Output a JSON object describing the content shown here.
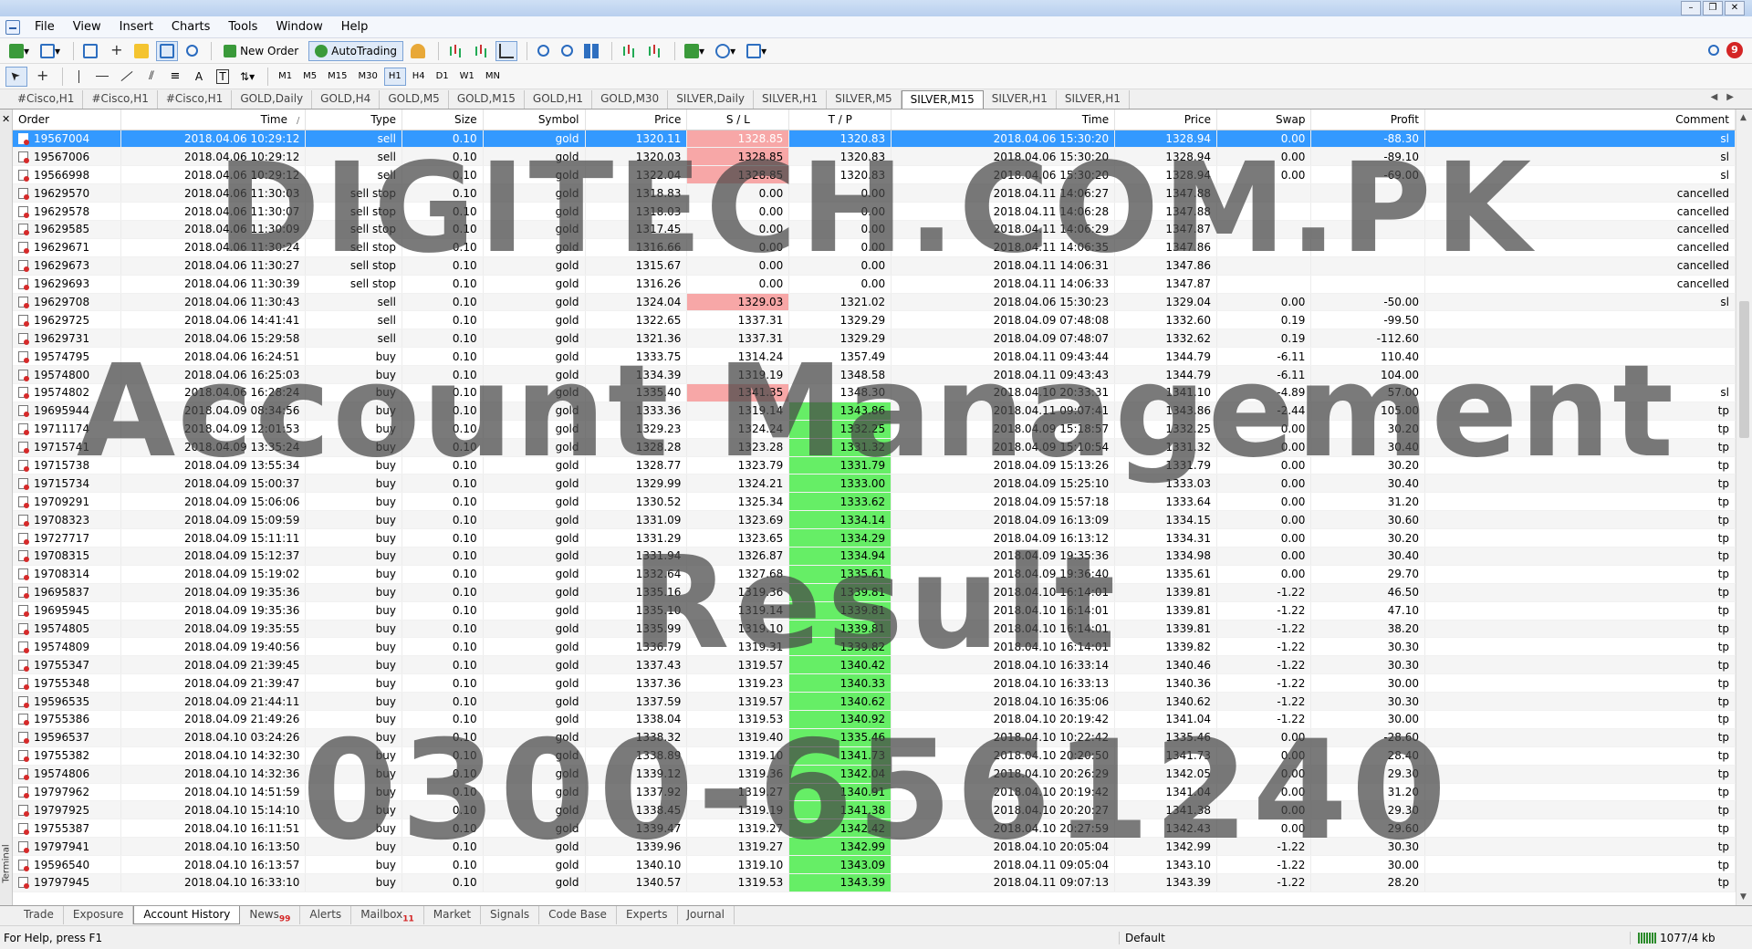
{
  "menu": [
    "File",
    "View",
    "Insert",
    "Charts",
    "Tools",
    "Window",
    "Help"
  ],
  "toolbar": {
    "new_order": "New Order",
    "auto_trading": "AutoTrading",
    "timeframes": [
      "M1",
      "M5",
      "M15",
      "M30",
      "H1",
      "H4",
      "D1",
      "W1",
      "MN"
    ],
    "active_timeframe": "H1",
    "notifications_count": "9"
  },
  "chart_tabs": [
    "#Cisco,H1",
    "#Cisco,H1",
    "#Cisco,H1",
    "GOLD,Daily",
    "GOLD,H4",
    "GOLD,M5",
    "GOLD,M15",
    "GOLD,H1",
    "GOLD,M30",
    "SILVER,Daily",
    "SILVER,H1",
    "SILVER,M5",
    "SILVER,M15",
    "SILVER,H1",
    "SILVER,H1"
  ],
  "active_chart_tab": 12,
  "terminal": {
    "side_label": "Terminal",
    "columns": [
      "Order",
      "Time",
      "Type",
      "Size",
      "Symbol",
      "Price",
      "S / L",
      "T / P",
      "Time",
      "Price",
      "Swap",
      "Profit",
      "Comment"
    ],
    "sort_mark": "/",
    "rows": [
      [
        "19567004",
        "2018.04.06 10:29:12",
        "sell",
        "0.10",
        "gold",
        "1320.11",
        "1328.85",
        "1320.83",
        "2018.04.06 15:30:20",
        "1328.94",
        "0.00",
        "-88.30",
        "sl"
      ],
      [
        "19567006",
        "2018.04.06 10:29:12",
        "sell",
        "0.10",
        "gold",
        "1320.03",
        "1328.85",
        "1320.83",
        "2018.04.06 15:30:20",
        "1328.94",
        "0.00",
        "-89.10",
        "sl"
      ],
      [
        "19566998",
        "2018.04.06 10:29:12",
        "sell",
        "0.10",
        "gold",
        "1322.04",
        "1328.85",
        "1320.83",
        "2018.04.06 15:30:20",
        "1328.94",
        "0.00",
        "-69.00",
        "sl"
      ],
      [
        "19629570",
        "2018.04.06 11:30:03",
        "sell stop",
        "0.10",
        "gold",
        "1318.83",
        "0.00",
        "0.00",
        "2018.04.11 14:06:27",
        "1347.88",
        "",
        "",
        "cancelled"
      ],
      [
        "19629578",
        "2018.04.06 11:30:07",
        "sell stop",
        "0.10",
        "gold",
        "1318.03",
        "0.00",
        "0.00",
        "2018.04.11 14:06:28",
        "1347.88",
        "",
        "",
        "cancelled"
      ],
      [
        "19629585",
        "2018.04.06 11:30:09",
        "sell stop",
        "0.10",
        "gold",
        "1317.45",
        "0.00",
        "0.00",
        "2018.04.11 14:06:29",
        "1347.87",
        "",
        "",
        "cancelled"
      ],
      [
        "19629671",
        "2018.04.06 11:30:24",
        "sell stop",
        "0.10",
        "gold",
        "1316.66",
        "0.00",
        "0.00",
        "2018.04.11 14:06:35",
        "1347.86",
        "",
        "",
        "cancelled"
      ],
      [
        "19629673",
        "2018.04.06 11:30:27",
        "sell stop",
        "0.10",
        "gold",
        "1315.67",
        "0.00",
        "0.00",
        "2018.04.11 14:06:31",
        "1347.86",
        "",
        "",
        "cancelled"
      ],
      [
        "19629693",
        "2018.04.06 11:30:39",
        "sell stop",
        "0.10",
        "gold",
        "1316.26",
        "0.00",
        "0.00",
        "2018.04.11 14:06:33",
        "1347.87",
        "",
        "",
        "cancelled"
      ],
      [
        "19629708",
        "2018.04.06 11:30:43",
        "sell",
        "0.10",
        "gold",
        "1324.04",
        "1329.03",
        "1321.02",
        "2018.04.06 15:30:23",
        "1329.04",
        "0.00",
        "-50.00",
        "sl"
      ],
      [
        "19629725",
        "2018.04.06 14:41:41",
        "sell",
        "0.10",
        "gold",
        "1322.65",
        "1337.31",
        "1329.29",
        "2018.04.09 07:48:08",
        "1332.60",
        "0.19",
        "-99.50",
        ""
      ],
      [
        "19629731",
        "2018.04.06 15:29:58",
        "sell",
        "0.10",
        "gold",
        "1321.36",
        "1337.31",
        "1329.29",
        "2018.04.09 07:48:07",
        "1332.62",
        "0.19",
        "-112.60",
        ""
      ],
      [
        "19574795",
        "2018.04.06 16:24:51",
        "buy",
        "0.10",
        "gold",
        "1333.75",
        "1314.24",
        "1357.49",
        "2018.04.11 09:43:44",
        "1344.79",
        "-6.11",
        "110.40",
        ""
      ],
      [
        "19574800",
        "2018.04.06 16:25:03",
        "buy",
        "0.10",
        "gold",
        "1334.39",
        "1319.19",
        "1348.58",
        "2018.04.11 09:43:43",
        "1344.79",
        "-6.11",
        "104.00",
        ""
      ],
      [
        "19574802",
        "2018.04.06 16:28:24",
        "buy",
        "0.10",
        "gold",
        "1335.40",
        "1341.35",
        "1348.30",
        "2018.04.10 20:33:31",
        "1341.10",
        "-4.89",
        "57.00",
        "sl"
      ],
      [
        "19695944",
        "2018.04.09 08:34:56",
        "buy",
        "0.10",
        "gold",
        "1333.36",
        "1319.14",
        "1343.86",
        "2018.04.11 09:07:41",
        "1343.86",
        "-2.44",
        "105.00",
        "tp"
      ],
      [
        "19711174",
        "2018.04.09 12:01:53",
        "buy",
        "0.10",
        "gold",
        "1329.23",
        "1324.24",
        "1332.25",
        "2018.04.09 15:18:57",
        "1332.25",
        "0.00",
        "30.20",
        "tp"
      ],
      [
        "19715741",
        "2018.04.09 13:35:24",
        "buy",
        "0.10",
        "gold",
        "1328.28",
        "1323.28",
        "1331.32",
        "2018.04.09 15:10:54",
        "1331.32",
        "0.00",
        "30.40",
        "tp"
      ],
      [
        "19715738",
        "2018.04.09 13:55:34",
        "buy",
        "0.10",
        "gold",
        "1328.77",
        "1323.79",
        "1331.79",
        "2018.04.09 15:13:26",
        "1331.79",
        "0.00",
        "30.20",
        "tp"
      ],
      [
        "19715734",
        "2018.04.09 15:00:37",
        "buy",
        "0.10",
        "gold",
        "1329.99",
        "1324.21",
        "1333.00",
        "2018.04.09 15:25:10",
        "1333.03",
        "0.00",
        "30.40",
        "tp"
      ],
      [
        "19709291",
        "2018.04.09 15:06:06",
        "buy",
        "0.10",
        "gold",
        "1330.52",
        "1325.34",
        "1333.62",
        "2018.04.09 15:57:18",
        "1333.64",
        "0.00",
        "31.20",
        "tp"
      ],
      [
        "19708323",
        "2018.04.09 15:09:59",
        "buy",
        "0.10",
        "gold",
        "1331.09",
        "1323.69",
        "1334.14",
        "2018.04.09 16:13:09",
        "1334.15",
        "0.00",
        "30.60",
        "tp"
      ],
      [
        "19727717",
        "2018.04.09 15:11:11",
        "buy",
        "0.10",
        "gold",
        "1331.29",
        "1323.65",
        "1334.29",
        "2018.04.09 16:13:12",
        "1334.31",
        "0.00",
        "30.20",
        "tp"
      ],
      [
        "19708315",
        "2018.04.09 15:12:37",
        "buy",
        "0.10",
        "gold",
        "1331.94",
        "1326.87",
        "1334.94",
        "2018.04.09 19:35:36",
        "1334.98",
        "0.00",
        "30.40",
        "tp"
      ],
      [
        "19708314",
        "2018.04.09 15:19:02",
        "buy",
        "0.10",
        "gold",
        "1332.64",
        "1327.68",
        "1335.61",
        "2018.04.09 19:36:40",
        "1335.61",
        "0.00",
        "29.70",
        "tp"
      ],
      [
        "19695837",
        "2018.04.09 19:35:36",
        "buy",
        "0.10",
        "gold",
        "1335.16",
        "1319.36",
        "1339.81",
        "2018.04.10 16:14:01",
        "1339.81",
        "-1.22",
        "46.50",
        "tp"
      ],
      [
        "19695945",
        "2018.04.09 19:35:36",
        "buy",
        "0.10",
        "gold",
        "1335.10",
        "1319.14",
        "1339.81",
        "2018.04.10 16:14:01",
        "1339.81",
        "-1.22",
        "47.10",
        "tp"
      ],
      [
        "19574805",
        "2018.04.09 19:35:55",
        "buy",
        "0.10",
        "gold",
        "1335.99",
        "1319.10",
        "1339.81",
        "2018.04.10 16:14:01",
        "1339.81",
        "-1.22",
        "38.20",
        "tp"
      ],
      [
        "19574809",
        "2018.04.09 19:40:56",
        "buy",
        "0.10",
        "gold",
        "1336.79",
        "1319.31",
        "1339.82",
        "2018.04.10 16:14:01",
        "1339.82",
        "-1.22",
        "30.30",
        "tp"
      ],
      [
        "19755347",
        "2018.04.09 21:39:45",
        "buy",
        "0.10",
        "gold",
        "1337.43",
        "1319.57",
        "1340.42",
        "2018.04.10 16:33:14",
        "1340.46",
        "-1.22",
        "30.30",
        "tp"
      ],
      [
        "19755348",
        "2018.04.09 21:39:47",
        "buy",
        "0.10",
        "gold",
        "1337.36",
        "1319.23",
        "1340.33",
        "2018.04.10 16:33:13",
        "1340.36",
        "-1.22",
        "30.00",
        "tp"
      ],
      [
        "19596535",
        "2018.04.09 21:44:11",
        "buy",
        "0.10",
        "gold",
        "1337.59",
        "1319.57",
        "1340.62",
        "2018.04.10 16:35:06",
        "1340.62",
        "-1.22",
        "30.30",
        "tp"
      ],
      [
        "19755386",
        "2018.04.09 21:49:26",
        "buy",
        "0.10",
        "gold",
        "1338.04",
        "1319.53",
        "1340.92",
        "2018.04.10 20:19:42",
        "1341.04",
        "-1.22",
        "30.00",
        "tp"
      ],
      [
        "19596537",
        "2018.04.10 03:24:26",
        "buy",
        "0.10",
        "gold",
        "1338.32",
        "1319.40",
        "1335.46",
        "2018.04.10 10:22:42",
        "1335.46",
        "0.00",
        "-28.60",
        "tp"
      ],
      [
        "19755382",
        "2018.04.10 14:32:30",
        "buy",
        "0.10",
        "gold",
        "1338.89",
        "1319.10",
        "1341.73",
        "2018.04.10 20:20:50",
        "1341.73",
        "0.00",
        "28.40",
        "tp"
      ],
      [
        "19574806",
        "2018.04.10 14:32:36",
        "buy",
        "0.10",
        "gold",
        "1339.12",
        "1319.36",
        "1342.04",
        "2018.04.10 20:26:29",
        "1342.05",
        "0.00",
        "29.30",
        "tp"
      ],
      [
        "19797962",
        "2018.04.10 14:51:59",
        "buy",
        "0.10",
        "gold",
        "1337.92",
        "1319.27",
        "1340.91",
        "2018.04.10 20:19:42",
        "1341.04",
        "0.00",
        "31.20",
        "tp"
      ],
      [
        "19797925",
        "2018.04.10 15:14:10",
        "buy",
        "0.10",
        "gold",
        "1338.45",
        "1319.19",
        "1341.38",
        "2018.04.10 20:20:27",
        "1341.38",
        "0.00",
        "29.30",
        "tp"
      ],
      [
        "19755387",
        "2018.04.10 16:11:51",
        "buy",
        "0.10",
        "gold",
        "1339.47",
        "1319.27",
        "1342.42",
        "2018.04.10 20:27:59",
        "1342.43",
        "0.00",
        "29.60",
        "tp"
      ],
      [
        "19797941",
        "2018.04.10 16:13:50",
        "buy",
        "0.10",
        "gold",
        "1339.96",
        "1319.27",
        "1342.99",
        "2018.04.10 20:05:04",
        "1342.99",
        "-1.22",
        "30.30",
        "tp"
      ],
      [
        "19596540",
        "2018.04.10 16:13:57",
        "buy",
        "0.10",
        "gold",
        "1340.10",
        "1319.10",
        "1343.09",
        "2018.04.11 09:05:04",
        "1343.10",
        "-1.22",
        "30.00",
        "tp"
      ],
      [
        "19797945",
        "2018.04.10 16:33:10",
        "buy",
        "0.10",
        "gold",
        "1340.57",
        "1319.53",
        "1343.39",
        "2018.04.11 09:07:13",
        "1343.39",
        "-1.22",
        "28.20",
        "tp"
      ]
    ],
    "selected_row": 0
  },
  "bottom_tabs": [
    {
      "label": "Trade",
      "badge": ""
    },
    {
      "label": "Exposure",
      "badge": ""
    },
    {
      "label": "Account History",
      "badge": ""
    },
    {
      "label": "News",
      "badge": "99"
    },
    {
      "label": "Alerts",
      "badge": ""
    },
    {
      "label": "Mailbox",
      "badge": "11"
    },
    {
      "label": "Market",
      "badge": ""
    },
    {
      "label": "Signals",
      "badge": ""
    },
    {
      "label": "Code Base",
      "badge": ""
    },
    {
      "label": "Experts",
      "badge": ""
    },
    {
      "label": "Journal",
      "badge": ""
    }
  ],
  "active_bottom_tab": 2,
  "status": {
    "help": "For Help, press F1",
    "profile": "Default",
    "traffic": "1077/4 kb"
  },
  "watermark": [
    "DIGITECH.COM.PK",
    "Account Management",
    "Result",
    "0300-6561240"
  ],
  "colors": {
    "selected_row": "#3399ff",
    "sl_highlight": "#f7a7a7",
    "tp_highlight": "#66ee66",
    "badge": "#d42525"
  }
}
